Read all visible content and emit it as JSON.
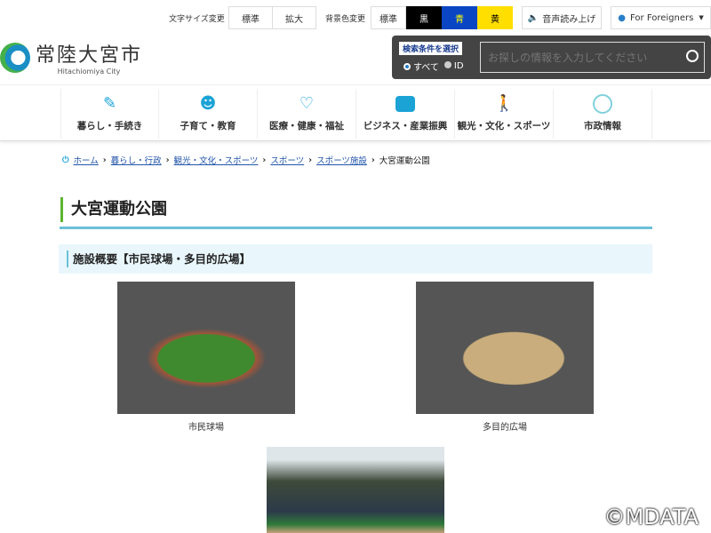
{
  "utility": {
    "font_size_label": "文字サイズ変更",
    "font_normal": "標準",
    "font_large": "拡大",
    "bg_label": "背景色変更",
    "bg_normal": "標準",
    "bg_black": "黒",
    "bg_blue": "青",
    "bg_yellow": "黄",
    "read_aloud": "音声読み上げ",
    "foreigners": "For Foreigners"
  },
  "logo": {
    "name": "常陸大宮市",
    "en": "Hitachiomiya City"
  },
  "search": {
    "condition": "検索条件を選択",
    "opt_all": "すべて",
    "opt_id": "ID",
    "placeholder": "お探しの情報を入力してください"
  },
  "nav": [
    "暮らし・手続き",
    "子育て・教育",
    "医療・健康・福祉",
    "ビジネス・産業振興",
    "観光・文化・スポーツ",
    "市政情報"
  ],
  "breadcrumb": [
    "ホーム",
    "暮らし・行政",
    "観光・文化・スポーツ",
    "スポーツ",
    "スポーツ施設",
    "大宮運動公園"
  ],
  "page_title": "大宮運動公園",
  "section_title": "施設概要【市民球場・多目的広場】",
  "photos": [
    {
      "caption": "市民球場"
    },
    {
      "caption": "多目的広場"
    }
  ],
  "watermark": "©MDATA"
}
